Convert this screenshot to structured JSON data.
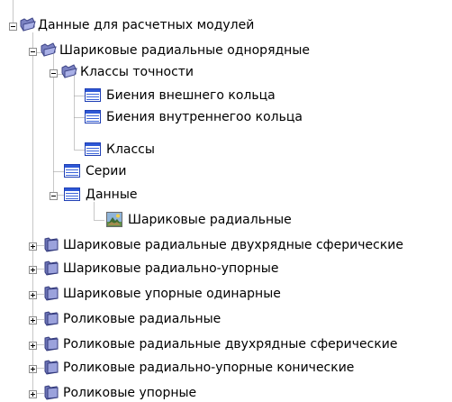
{
  "tree": {
    "nodes": [
      {
        "label": "Данные для расчетных модулей",
        "icon": "folder-open-icon",
        "expanded": true
      },
      {
        "label": "Шариковые радиальные однорядные",
        "icon": "folder-open-icon",
        "expanded": true
      },
      {
        "label": "Классы точности",
        "icon": "folder-open-icon",
        "expanded": true
      },
      {
        "label": "Биения внешнего кольца",
        "icon": "table-icon"
      },
      {
        "label": "Биения внутреннегоо кольца",
        "icon": "table-icon"
      },
      {
        "label": "Классы",
        "icon": "table-icon"
      },
      {
        "label": "Серии",
        "icon": "table-icon"
      },
      {
        "label": "Данные",
        "icon": "table-icon",
        "expanded": true
      },
      {
        "label": "Шариковые радиальные",
        "icon": "image-icon"
      },
      {
        "label": "Шариковые радиальные двухрядные сферические",
        "icon": "folder-closed-icon",
        "expanded": false
      },
      {
        "label": "Шариковые радиально-упорные",
        "icon": "folder-closed-icon",
        "expanded": false
      },
      {
        "label": "Шариковые упорные одинарные",
        "icon": "folder-closed-icon",
        "expanded": false
      },
      {
        "label": "Роликовые радиальные",
        "icon": "folder-closed-icon",
        "expanded": false
      },
      {
        "label": "Роликовые радиальные двухрядные сферические",
        "icon": "folder-closed-icon",
        "expanded": false
      },
      {
        "label": "Роликовые радиально-упорные конические",
        "icon": "folder-closed-icon",
        "expanded": false
      },
      {
        "label": "Роликовые упорные",
        "icon": "folder-closed-icon",
        "expanded": false
      }
    ]
  }
}
